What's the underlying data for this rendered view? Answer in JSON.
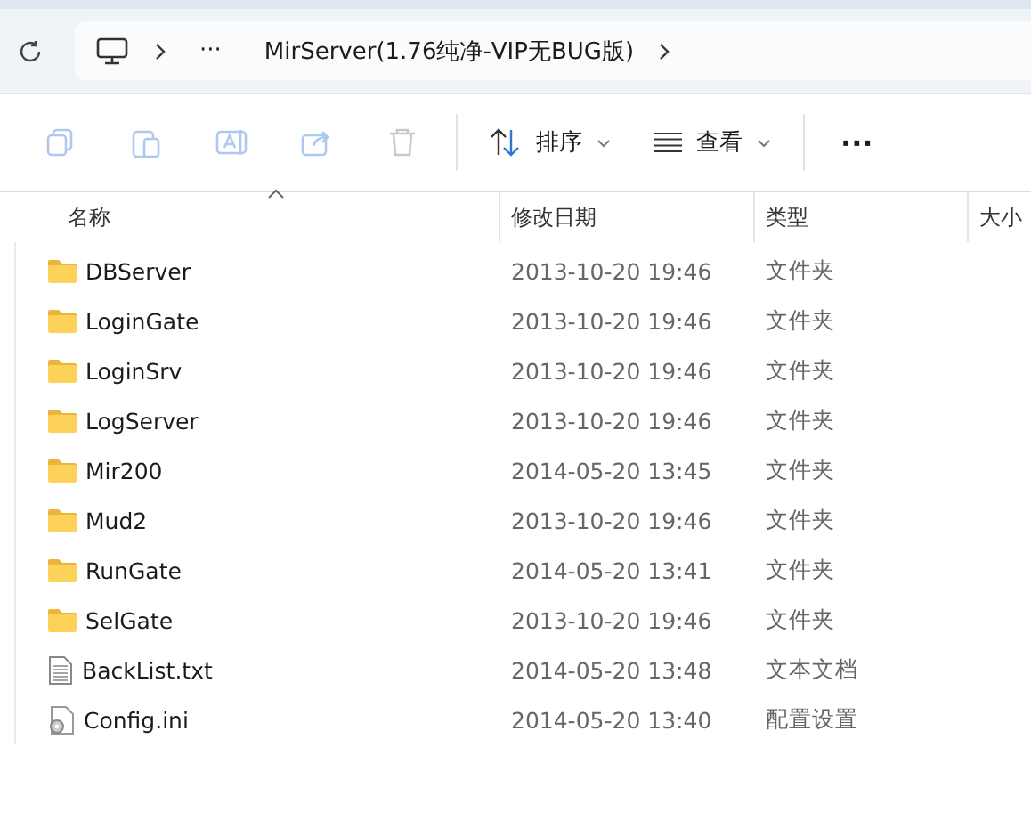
{
  "address_bar": {
    "path": "MirServer(1.76纯净-VIP无BUG版)",
    "overflow": "···"
  },
  "toolbar": {
    "icon_buttons": [
      {
        "kind": "copy",
        "disabled": true
      },
      {
        "kind": "paste",
        "disabled": true
      },
      {
        "kind": "rename",
        "disabled": true
      },
      {
        "kind": "share",
        "disabled": true
      },
      {
        "kind": "delete",
        "disabled": true
      }
    ],
    "sort": {
      "label": "排序"
    },
    "view": {
      "label": "查看"
    },
    "more": "···"
  },
  "table": {
    "columns": [
      "名称",
      "修改日期",
      "类型",
      "大小"
    ],
    "rows": [
      {
        "kind": "folder",
        "name": "DBServer",
        "modified": "2013-10-20 19:46",
        "type": "文件夹"
      },
      {
        "kind": "folder",
        "name": "LoginGate",
        "modified": "2013-10-20 19:46",
        "type": "文件夹"
      },
      {
        "kind": "folder",
        "name": "LoginSrv",
        "modified": "2013-10-20 19:46",
        "type": "文件夹"
      },
      {
        "kind": "folder",
        "name": "LogServer",
        "modified": "2013-10-20 19:46",
        "type": "文件夹"
      },
      {
        "kind": "folder",
        "name": "Mir200",
        "modified": "2014-05-20 13:45",
        "type": "文件夹"
      },
      {
        "kind": "folder",
        "name": "Mud2",
        "modified": "2013-10-20 19:46",
        "type": "文件夹"
      },
      {
        "kind": "folder",
        "name": "RunGate",
        "modified": "2014-05-20 13:41",
        "type": "文件夹"
      },
      {
        "kind": "folder",
        "name": "SelGate",
        "modified": "2013-10-20 19:46",
        "type": "文件夹"
      },
      {
        "kind": "text",
        "name": "BackList.txt",
        "modified": "2014-05-20 13:48",
        "type": "文本文档"
      },
      {
        "kind": "config",
        "name": "Config.ini",
        "modified": "2014-05-20 13:40",
        "type": "配置设置"
      }
    ]
  }
}
